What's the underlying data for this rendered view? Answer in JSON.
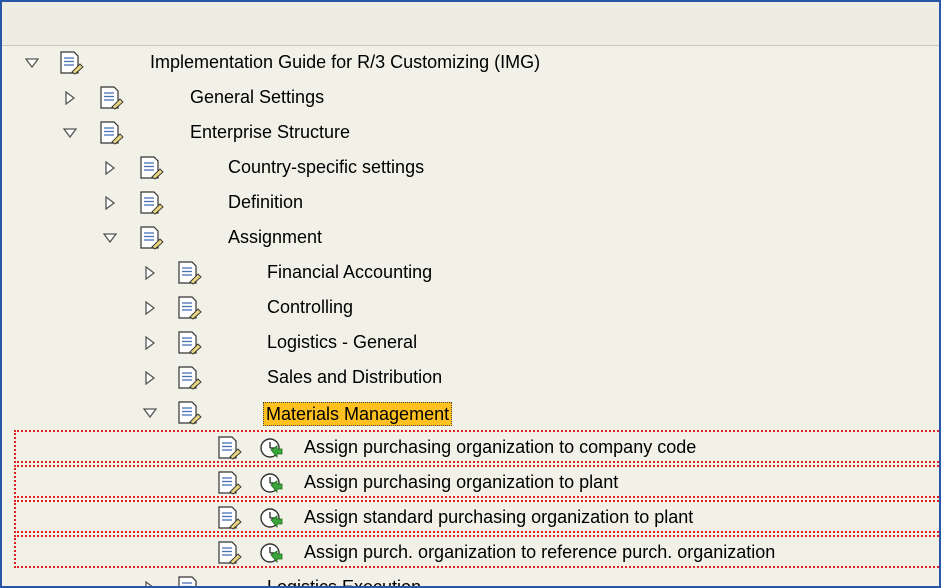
{
  "tree": {
    "root": {
      "label": "Implementation Guide for R/3 Customizing (IMG)",
      "state": "expanded",
      "icon": "document-icon"
    },
    "level1": [
      {
        "label": "General Settings",
        "state": "collapsed"
      },
      {
        "label": "Enterprise Structure",
        "state": "expanded"
      }
    ],
    "level2": [
      {
        "label": "Country-specific settings",
        "state": "collapsed"
      },
      {
        "label": "Definition",
        "state": "collapsed"
      },
      {
        "label": "Assignment",
        "state": "expanded"
      }
    ],
    "level3": [
      {
        "label": "Financial Accounting",
        "state": "collapsed"
      },
      {
        "label": "Controlling",
        "state": "collapsed"
      },
      {
        "label": "Logistics - General",
        "state": "collapsed"
      },
      {
        "label": "Sales and Distribution",
        "state": "collapsed"
      },
      {
        "label": "Materials Management",
        "state": "expanded",
        "selected": true
      },
      {
        "label": "Logistics Execution",
        "state": "collapsed"
      }
    ],
    "activities": [
      {
        "label": "Assign purchasing organization to company code",
        "icon": "execute-clock-icon"
      },
      {
        "label": "Assign purchasing organization to plant",
        "icon": "execute-clock-icon"
      },
      {
        "label": "Assign standard purchasing organization to plant",
        "icon": "execute-clock-icon"
      },
      {
        "label": "Assign purch. organization to reference purch. organization",
        "icon": "execute-clock-icon"
      }
    ]
  },
  "colors": {
    "frame_border": "#2a56a8",
    "background": "#f2f1e7",
    "selection": "#ffc11f",
    "highlight_border": "#e02020"
  }
}
